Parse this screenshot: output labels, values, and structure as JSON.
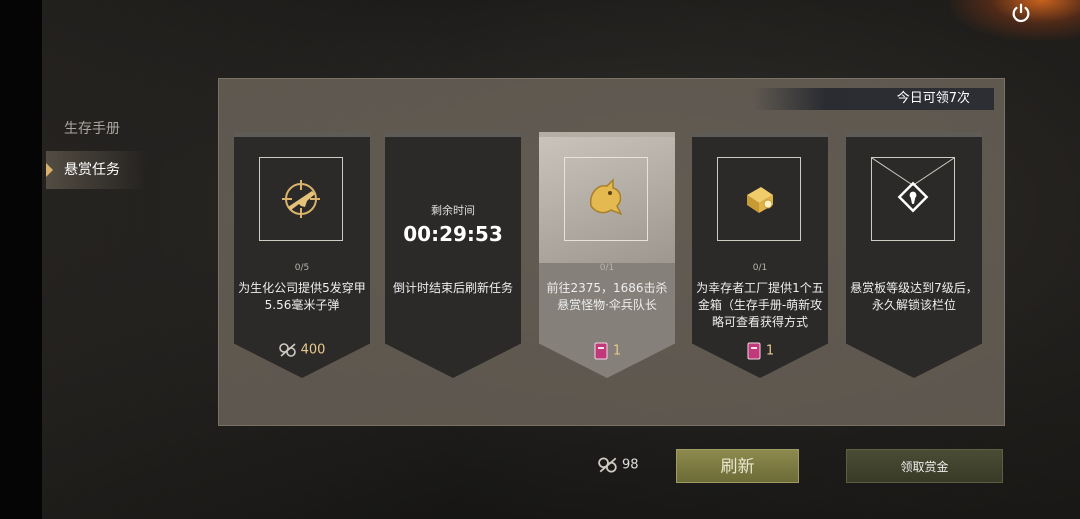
{
  "sidebar": {
    "items": [
      {
        "label": "生存手册",
        "active": false
      },
      {
        "label": "悬赏任务",
        "active": true
      }
    ]
  },
  "panel": {
    "daily_limit": "今日可领7次"
  },
  "cards": [
    {
      "icon": "rifle-crosshair-icon",
      "progress": "0/5",
      "description": "为生化公司提供5发穿甲5.56毫米子弹",
      "reward_icon": "scrap-parts-icon",
      "reward_value": "400"
    },
    {
      "timer_label": "剩余时间",
      "timer": "00:29:53",
      "description": "倒计时结束后刷新任务"
    },
    {
      "icon": "gold-dragon-icon",
      "progress": "0/1",
      "description": "前往2375，1686击杀悬赏怪物·伞兵队长",
      "reward_icon": "pink-book-icon",
      "reward_value": "1"
    },
    {
      "icon": "gold-box-icon",
      "progress": "0/1",
      "description": "为幸存者工厂提供1个五金箱（生存手册-萌新攻略可查看获得方式",
      "reward_icon": "pink-book-icon",
      "reward_value": "1"
    },
    {
      "icon": "lock-diamond-icon",
      "description": "悬赏板等级达到7级后，永久解锁该栏位"
    }
  ],
  "footer": {
    "currency_icon": "scrap-parts-icon",
    "currency_value": "98",
    "refresh_label": "刷新",
    "claim_label": "领取赏金"
  },
  "colors": {
    "accent_gold": "#e8c98c",
    "refresh_button": "#7d7b42",
    "claim_button": "#42432e"
  }
}
